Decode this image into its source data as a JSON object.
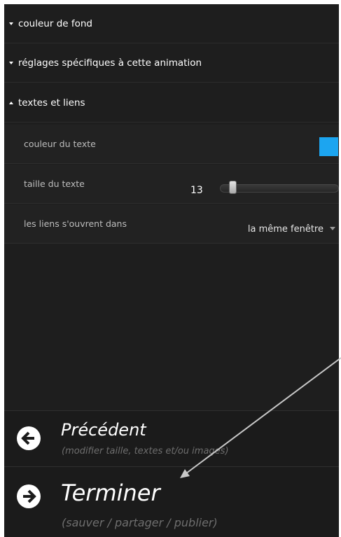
{
  "sections": [
    {
      "label": "couleur de fond",
      "expanded": false
    },
    {
      "label": "réglages spécifiques à cette animation",
      "expanded": false
    },
    {
      "label": "textes et liens",
      "expanded": true
    }
  ],
  "settings": {
    "text_color": {
      "label": "couleur du texte",
      "color": "#1ca5f0"
    },
    "text_size": {
      "label": "taille du texte",
      "value": "13"
    },
    "links_open": {
      "label": "les liens s'ouvrent dans",
      "value": "la même fenêtre"
    }
  },
  "buttons": {
    "previous": {
      "title": "Précédent",
      "subtitle": "(modifier taille, textes et/ou images)"
    },
    "finish": {
      "title": "Terminer",
      "subtitle": "(sauver / partager / publier)"
    }
  },
  "colors": {
    "accent": "#1ca5f0",
    "panel": "#1e1e1e",
    "row": "#222222"
  }
}
